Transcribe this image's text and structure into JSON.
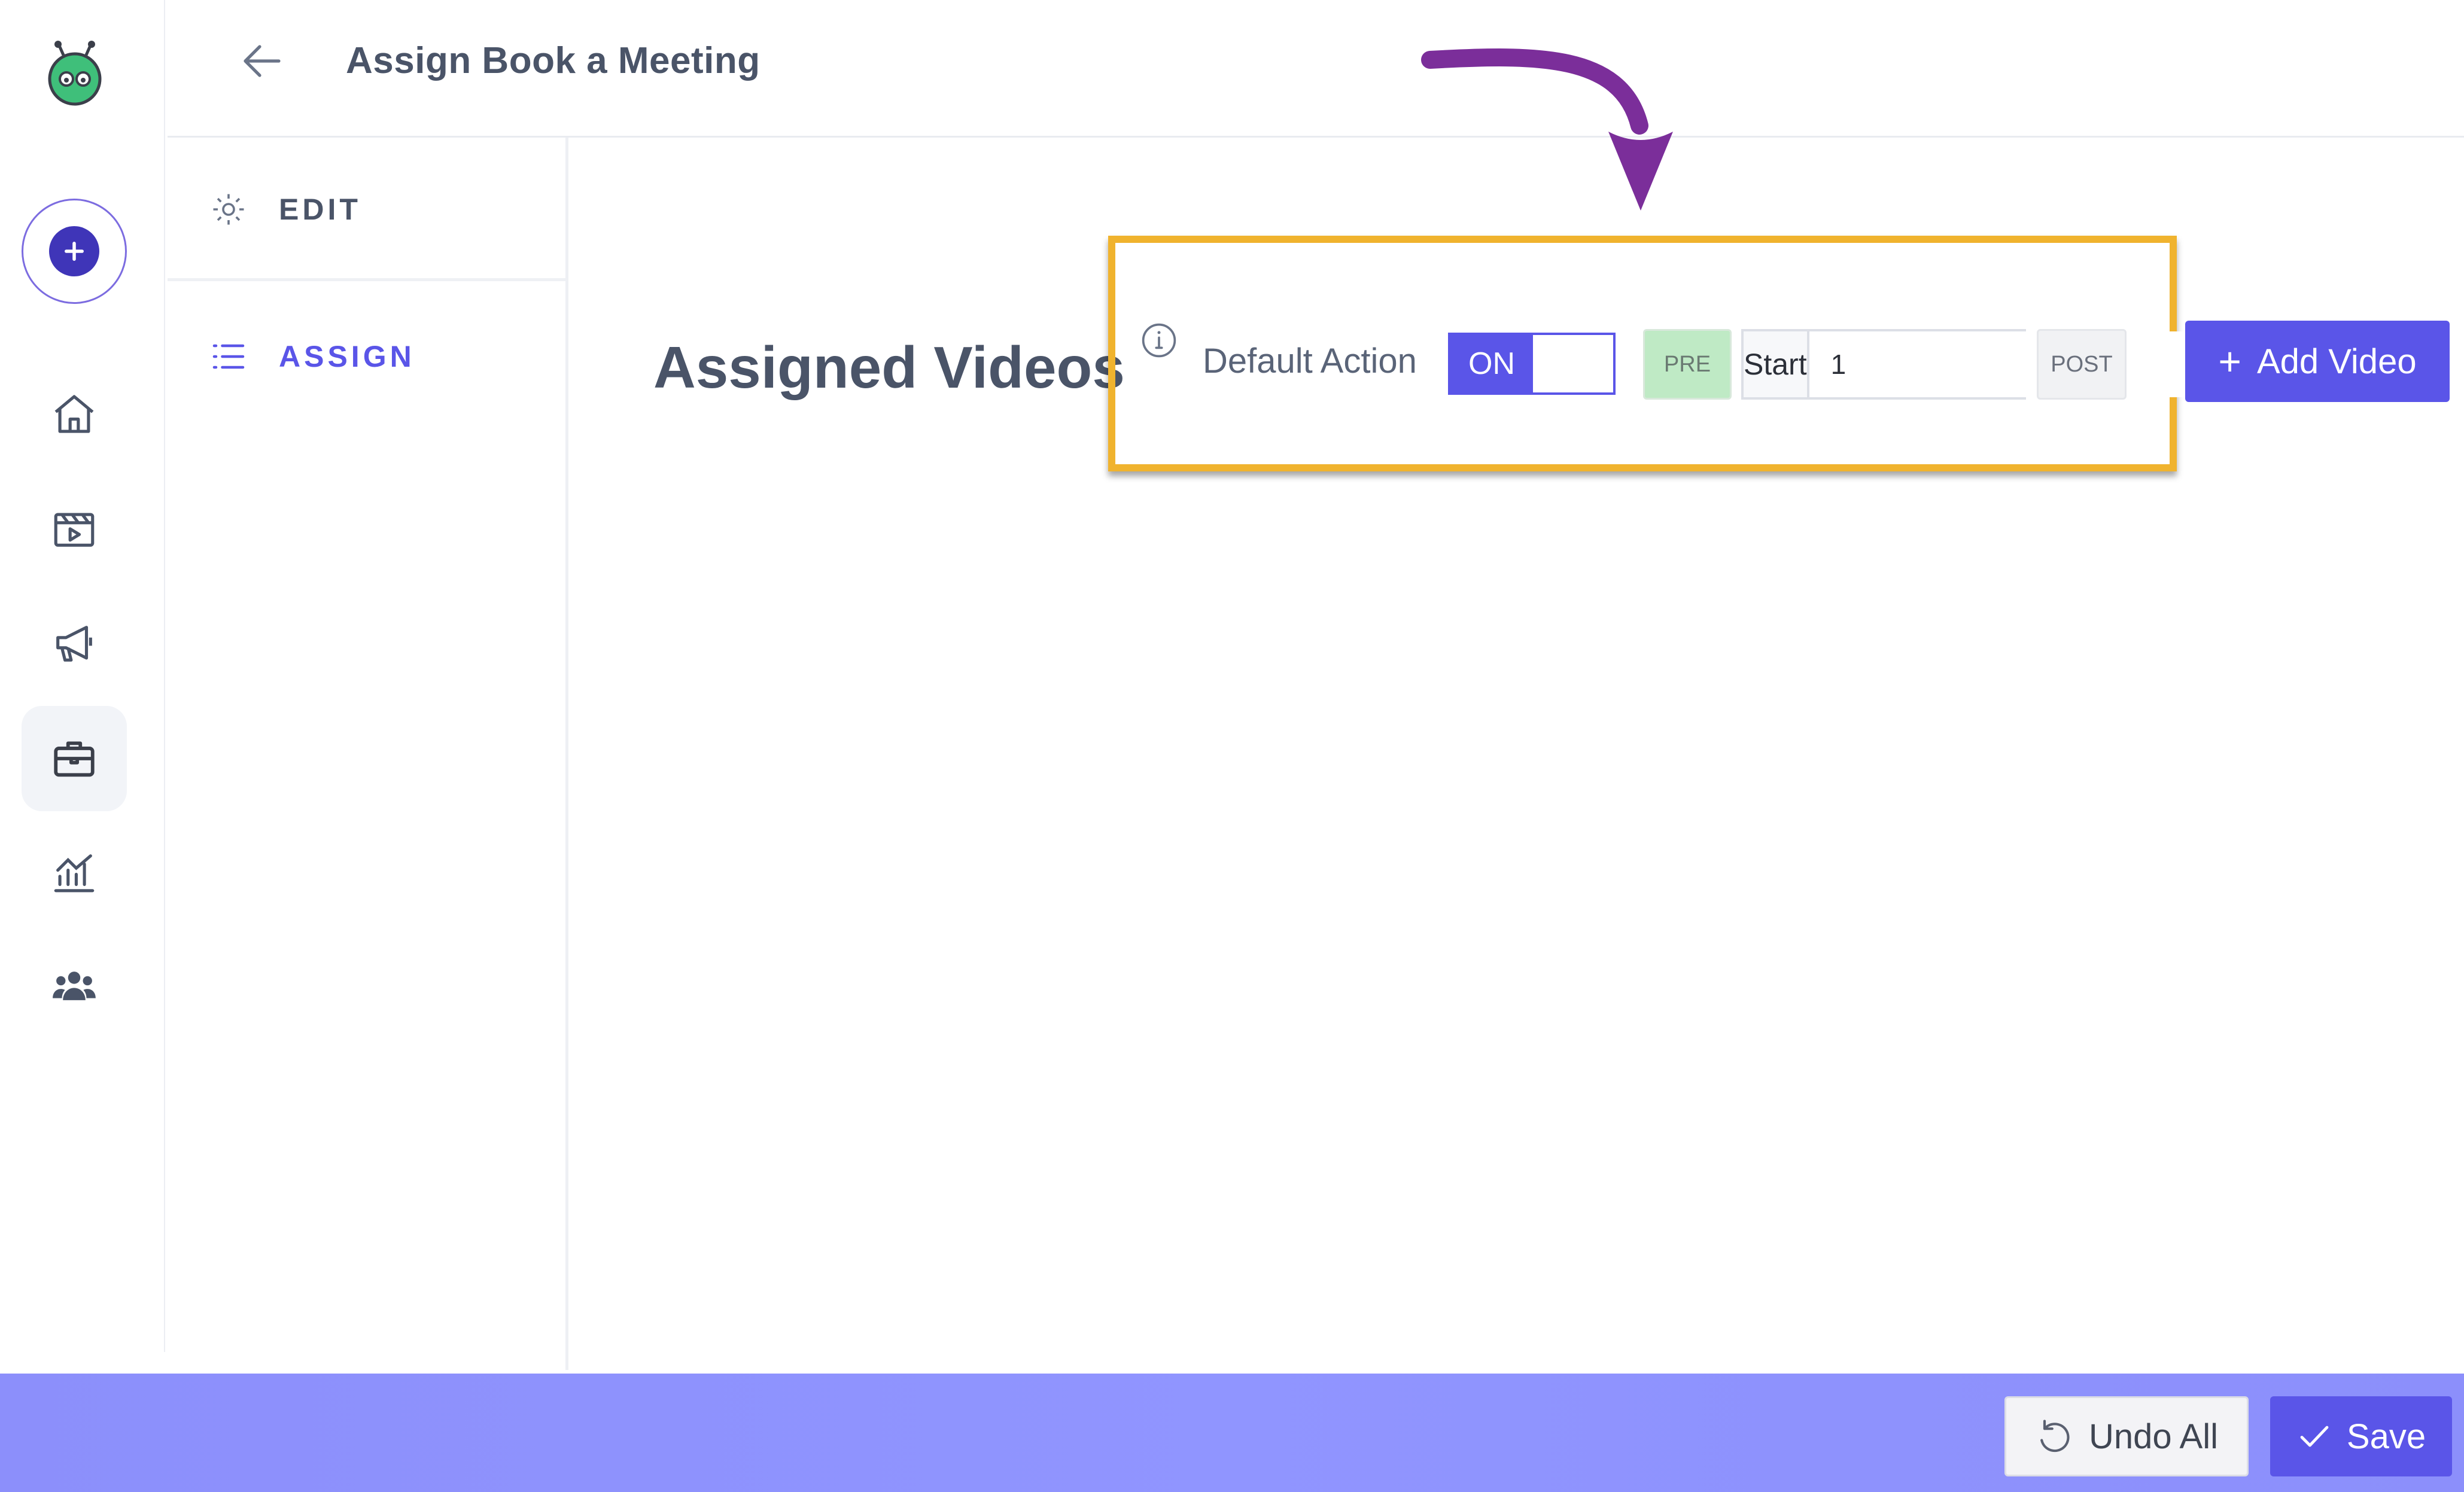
{
  "header": {
    "title": "Assign Book a Meeting"
  },
  "rail": {
    "items": [
      {
        "icon": "home-icon"
      },
      {
        "icon": "video-icon"
      },
      {
        "icon": "megaphone-icon"
      },
      {
        "icon": "briefcase-icon",
        "active": true
      },
      {
        "icon": "analytics-icon"
      },
      {
        "icon": "users-icon"
      }
    ]
  },
  "sidenav": {
    "edit_label": "EDIT",
    "assign_label": "ASSIGN"
  },
  "main": {
    "heading": "Assigned Videos",
    "default_action": {
      "label": "Default Action",
      "toggle_label": "ON",
      "toggle_state": "on",
      "pre_label": "PRE",
      "start_label": "Start",
      "start_value": "1",
      "post_label": "POST"
    },
    "add_video_label": "Add Video"
  },
  "footer": {
    "undo_label": "Undo All",
    "save_label": "Save"
  },
  "colors": {
    "accent": "#5a55e8",
    "highlight": "#f0b32e",
    "annotation_arrow": "#7b2e9a",
    "footer": "#8c8ffb",
    "pre_active": "#bfeac5"
  }
}
